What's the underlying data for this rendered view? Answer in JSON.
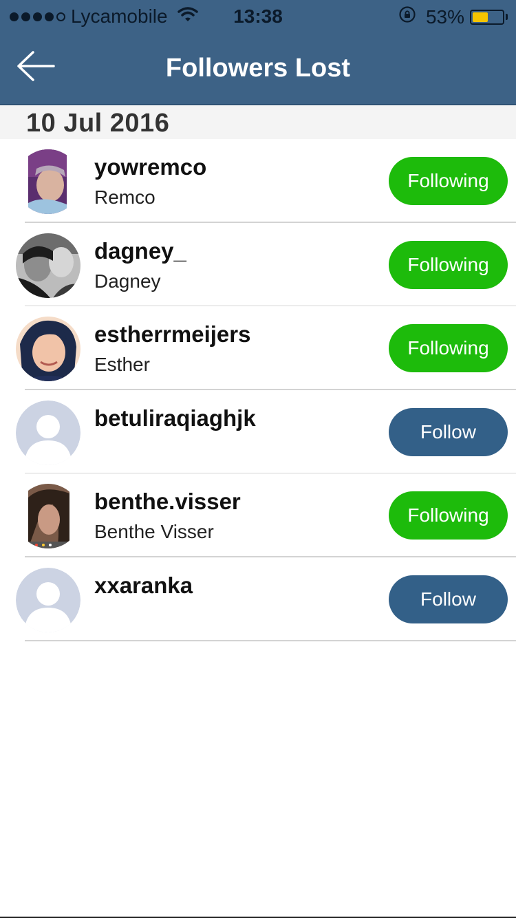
{
  "status_bar": {
    "carrier": "Lycamobile",
    "time": "13:38",
    "battery_percent": "53%",
    "battery_level": 0.53,
    "signal_bars": 4,
    "icons": [
      "signal-dots-icon",
      "wifi-icon",
      "rotation-lock-icon",
      "battery-icon"
    ]
  },
  "nav": {
    "title": "Followers Lost",
    "back_icon": "arrow-left-icon"
  },
  "section": {
    "date": "10 Jul 2016"
  },
  "users": [
    {
      "username": "yowremco",
      "fullname": "Remco",
      "button": "Following",
      "status": "following",
      "avatar": "photo"
    },
    {
      "username": "dagney_",
      "fullname": "Dagney",
      "button": "Following",
      "status": "following",
      "avatar": "photo"
    },
    {
      "username": "estherrmeijers",
      "fullname": "Esther",
      "button": "Following",
      "status": "following",
      "avatar": "photo"
    },
    {
      "username": "betuliraqiaghjk",
      "fullname": "",
      "button": "Follow",
      "status": "follow",
      "avatar": "placeholder"
    },
    {
      "username": "benthe.visser",
      "fullname": "Benthe Visser",
      "button": "Following",
      "status": "following",
      "avatar": "photo"
    },
    {
      "username": "xxaranka",
      "fullname": "",
      "button": "Follow",
      "status": "follow",
      "avatar": "placeholder"
    }
  ],
  "colors": {
    "header": "#3d6286",
    "following": "#1dbb0b",
    "follow": "#336088",
    "battery": "#f5c400"
  }
}
